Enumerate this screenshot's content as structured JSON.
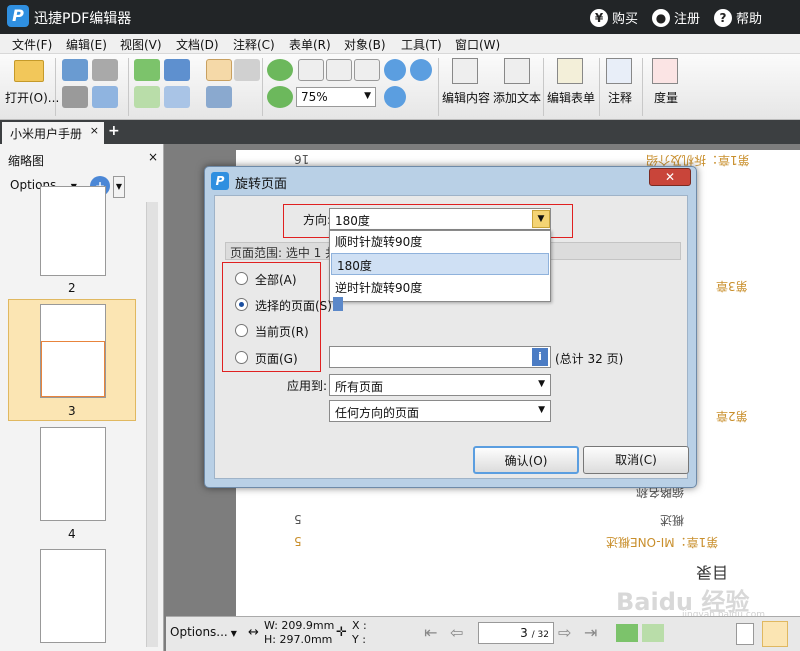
{
  "app": {
    "title": "迅捷PDF编辑器",
    "logo": "P",
    "buy": "购买",
    "register": "注册",
    "help": "帮助"
  },
  "menu": [
    "文件(F)",
    "编辑(E)",
    "视图(V)",
    "文档(D)",
    "注释(C)",
    "表单(R)",
    "对象(B)",
    "工具(T)",
    "窗口(W)"
  ],
  "toolbar": {
    "open_label": "打开(O)...",
    "zoom_value": "75%",
    "edit_content": "编辑内容",
    "add_text": "添加文本",
    "edit_form": "编辑表单",
    "annotate": "注释",
    "measure": "度量"
  },
  "tab": {
    "label": "小米用户手册",
    "add": "+"
  },
  "sidebar": {
    "title": "缩略图",
    "options": "Options...",
    "thumbs": [
      "2",
      "3",
      "4"
    ]
  },
  "document": {
    "lines": [
      "16",
      "第1章：拆机及介绍",
      "第3章",
      "第2章",
      "缩略名称",
      "5",
      "概述",
      "5",
      "第1章：MI-ONE概述",
      "目录"
    ]
  },
  "bottom": {
    "options": "Options...",
    "width": "W: 209.9mm",
    "height": "H: 297.0mm",
    "x": "X :",
    "y": "Y :",
    "page": "3",
    "total": "/ 32"
  },
  "dialog": {
    "title": "旋转页面",
    "direction_label": "方向:",
    "direction_value": "180度",
    "dropdown_options": [
      "顺时针旋转90度",
      "180度",
      "逆时针旋转90度"
    ],
    "range_header": "页面范围: 选中 1 共",
    "radios": [
      "全部(A)",
      "选择的页面(S)",
      "当前页(R)",
      "页面(G)"
    ],
    "total_pages": "(总计 32 页)",
    "apply_label": "应用到:",
    "apply_value": "所有页面",
    "orientation_value": "任何方向的页面",
    "ok": "确认(O)",
    "cancel": "取消(C)"
  },
  "watermark": "Baidu 经验",
  "watermark_url": "jingyan.baidu.com"
}
